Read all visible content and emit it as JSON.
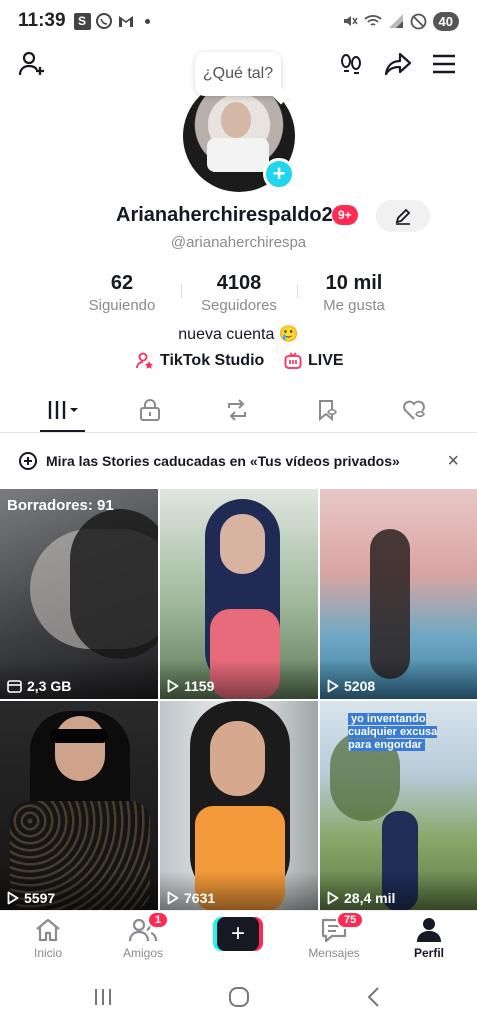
{
  "status_bar": {
    "time": "11:39",
    "app_badge": "S",
    "battery": "40"
  },
  "bubble_text": "¿Qué tal?",
  "profile": {
    "username": "Arianaherchirespaldo2",
    "notif_badge": "9+",
    "handle": "@arianaherchirespa",
    "bio": "nueva cuenta 🥲"
  },
  "stats": [
    {
      "num": "62",
      "label": "Siguiendo"
    },
    {
      "num": "4108",
      "label": "Seguidores"
    },
    {
      "num": "10 mil",
      "label": "Me gusta"
    }
  ],
  "links": {
    "studio": "TikTok Studio",
    "live": "LIVE"
  },
  "banner": {
    "text": "Mira las Stories caducadas en «Tus vídeos privados»",
    "close": "×"
  },
  "videos": [
    {
      "top_label": "Borradores: 91",
      "count": "2,3 GB",
      "icon": "storage-icon"
    },
    {
      "count": "1159",
      "icon": "play-icon"
    },
    {
      "count": "5208",
      "icon": "play-icon"
    },
    {
      "count": "5597",
      "icon": "play-icon"
    },
    {
      "count": "7631",
      "icon": "play-icon"
    },
    {
      "count": "28,4 mil",
      "icon": "play-icon",
      "caption": "yo inventando cualquier excusa para engordar"
    }
  ],
  "bottom_nav": {
    "home": "Inicio",
    "friends": "Amigos",
    "friends_badge": "1",
    "create": "+",
    "inbox": "Mensajes",
    "inbox_badge": "75",
    "profile": "Perfil"
  },
  "colors": {
    "accent": "#fe2c55",
    "cyan": "#25f4ee",
    "text": "#161823",
    "muted": "#8a8b91"
  }
}
